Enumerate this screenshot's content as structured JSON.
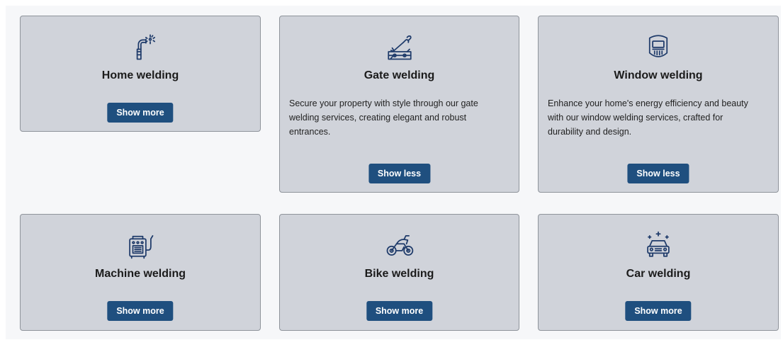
{
  "colors": {
    "card_background": "#d0d3da",
    "card_border": "#8f949b",
    "button_background": "#1f4f7f",
    "button_text": "#ffffff",
    "icon_color": "#1f3b6a",
    "page_background": "#f6f7f9"
  },
  "cards": [
    {
      "id": "home",
      "title": "Home welding",
      "icon": "welding-torch-icon",
      "expanded": false,
      "description": "",
      "button_label": "Show more"
    },
    {
      "id": "gate",
      "title": "Gate welding",
      "icon": "gate-welding-icon",
      "expanded": true,
      "description": "Secure your property with style through our gate welding services, creating elegant and robust entrances.",
      "button_label": "Show less"
    },
    {
      "id": "window",
      "title": "Window welding",
      "icon": "welding-mask-icon",
      "expanded": true,
      "description": "Enhance your home's energy efficiency and beauty with our window welding services, crafted for durability and design.",
      "button_label": "Show less"
    },
    {
      "id": "machine",
      "title": "Machine welding",
      "icon": "welding-machine-icon",
      "expanded": false,
      "description": "",
      "button_label": "Show more"
    },
    {
      "id": "bike",
      "title": "Bike welding",
      "icon": "motorbike-icon",
      "expanded": false,
      "description": "",
      "button_label": "Show more"
    },
    {
      "id": "car",
      "title": "Car welding",
      "icon": "car-icon",
      "expanded": false,
      "description": "",
      "button_label": "Show more"
    }
  ]
}
